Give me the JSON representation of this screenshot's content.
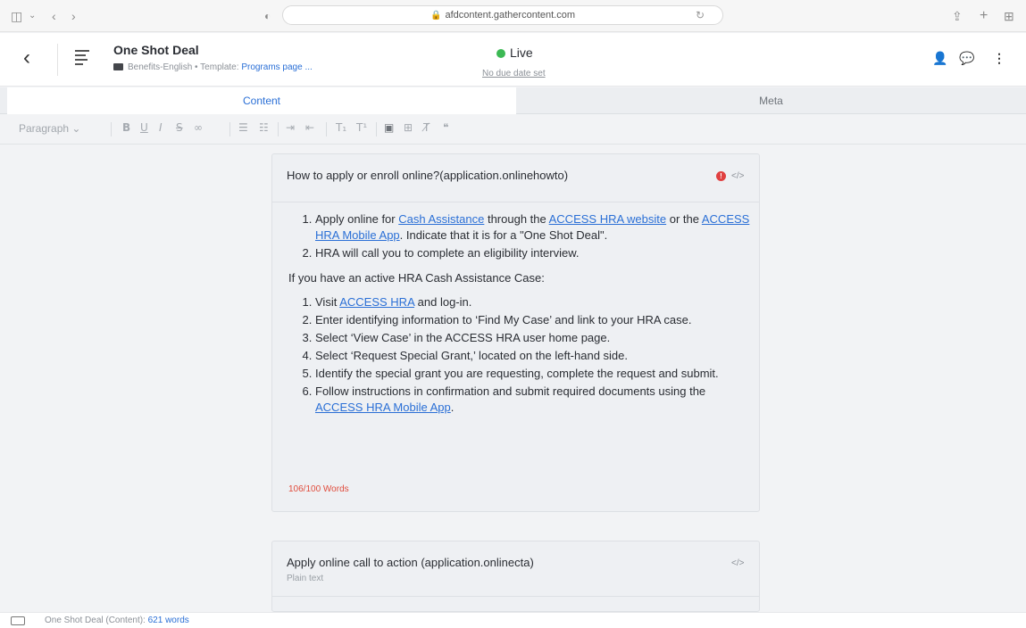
{
  "browser": {
    "url": "afdcontent.gathercontent.com"
  },
  "header": {
    "title": "One Shot Deal",
    "folder": "Benefits-English",
    "separator": "•",
    "template_label": "Template:",
    "template_link": "Programs page ...",
    "status": "Live",
    "status_color": "#3cb954",
    "due_date": "No due date set"
  },
  "tabs": [
    {
      "label": "Content",
      "active": true
    },
    {
      "label": "Meta",
      "active": false
    }
  ],
  "toolbar": {
    "paragraph_select": "Paragraph"
  },
  "fields": [
    {
      "title": "How to apply or enroll online?(application.onlinehowto)",
      "steps_a": [
        {
          "pre": "Apply online for ",
          "link1": "Cash Assistance",
          "mid": " through the ",
          "link2": "ACCESS HRA website",
          "mid2": " or the ",
          "link3": "ACCESS HRA Mobile App",
          "post": ". Indicate that it is for a \"One Shot Deal\"."
        },
        {
          "text": "HRA will call you to complete an eligibility interview."
        }
      ],
      "paragraph": "If you have an active HRA Cash Assistance Case:",
      "steps_b": [
        {
          "pre": "Visit ",
          "link": "ACCESS HRA",
          "post": " and log-in."
        },
        {
          "text": "Enter identifying information to ‘Find My Case’ and link to your HRA case."
        },
        {
          "text": "Select ‘View Case’ in the ACCESS HRA user home page."
        },
        {
          "text": "Select ‘Request Special Grant,’ located on the left-hand side."
        },
        {
          "text": "Identify the special grant you are requesting, complete the request and submit."
        },
        {
          "pre": "Follow instructions in confirmation and submit required documents using the ",
          "link": "ACCESS HRA Mobile App",
          "post": "."
        }
      ],
      "word_count": "106/100 Words"
    },
    {
      "title": "Apply online call to action (application.onlinecta)",
      "subtitle": "Plain text"
    }
  ],
  "footer": {
    "label": "One Shot Deal (Content):",
    "count": "621 words"
  }
}
